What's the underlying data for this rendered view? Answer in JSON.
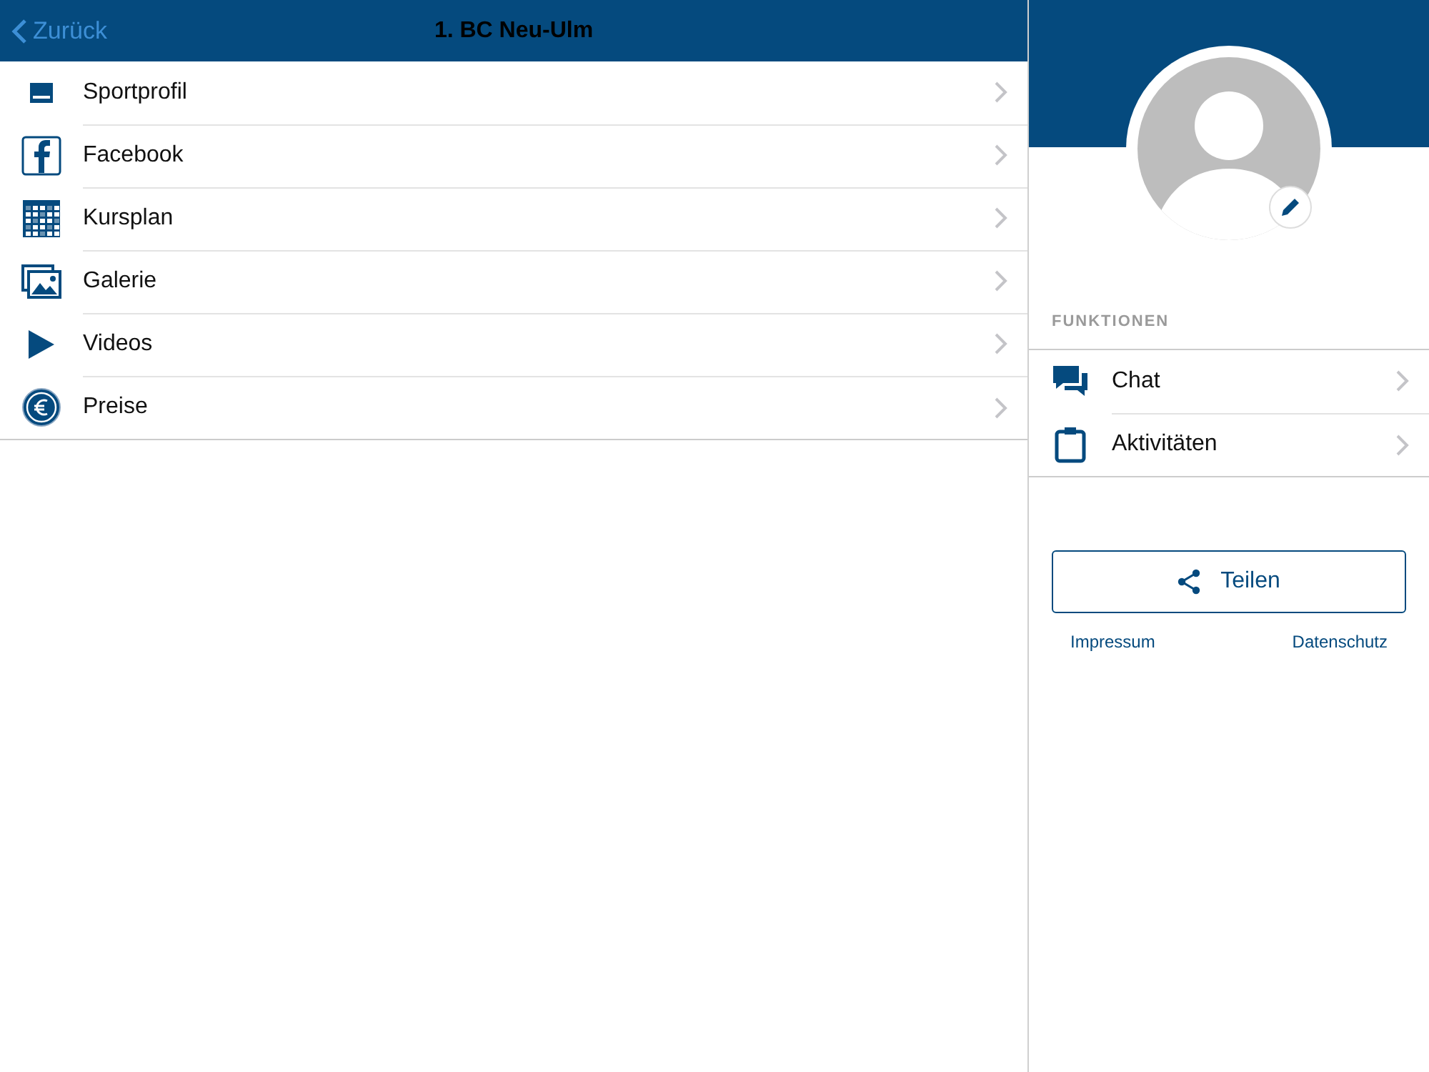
{
  "nav_bar": {
    "back": "Zurück",
    "title": "1. BC Neu-Ulm"
  },
  "menu": [
    {
      "kind": "profile",
      "label": "Sportprofil"
    },
    {
      "kind": "facebook",
      "label": "Facebook"
    },
    {
      "kind": "schedule",
      "label": "Kursplan"
    },
    {
      "kind": "gallery",
      "label": "Galerie"
    },
    {
      "kind": "video",
      "label": "Videos"
    },
    {
      "kind": "price",
      "label": "Preise"
    }
  ],
  "side_panel": {
    "section_title": "FUNKTIONEN",
    "functions": [
      {
        "kind": "chat",
        "label": "Chat"
      },
      {
        "kind": "activities",
        "label": "Aktivitäten"
      }
    ],
    "share_button": "Teilen",
    "links": [
      "Impressum",
      "Datenschutz"
    ]
  }
}
